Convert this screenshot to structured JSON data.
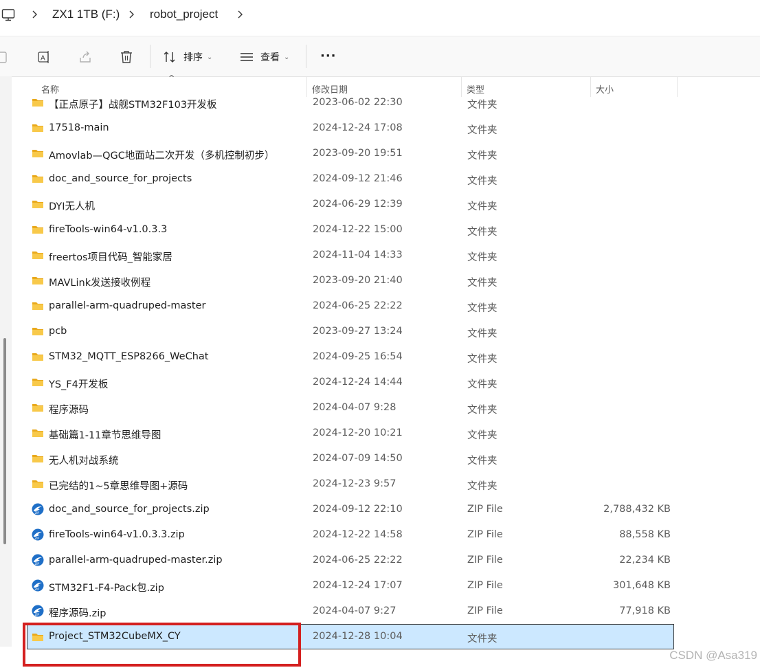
{
  "breadcrumb": {
    "icon": "computer-icon",
    "items": [
      "ZX1 1TB (F:)",
      "robot_project"
    ]
  },
  "toolbar": {
    "sort_label": "排序",
    "view_label": "查看",
    "more_label": "···",
    "icons": [
      "copy-icon",
      "rename-icon",
      "share-icon",
      "delete-icon",
      "sort-icon",
      "view-icon"
    ]
  },
  "columns": {
    "name": "名称",
    "date": "修改日期",
    "type": "类型",
    "size": "大小"
  },
  "files": [
    {
      "name": "【正点原子】战舰STM32F103开发板",
      "date": "2023-06-02 22:30",
      "type": "文件夹",
      "size": "",
      "icon": "folder-icon"
    },
    {
      "name": "17518-main",
      "date": "2024-12-24 17:08",
      "type": "文件夹",
      "size": "",
      "icon": "folder-icon"
    },
    {
      "name": "Amovlab—QGC地面站二次开发（多机控制初步）",
      "date": "2023-09-20 19:51",
      "type": "文件夹",
      "size": "",
      "icon": "folder-icon"
    },
    {
      "name": "doc_and_source_for_projects",
      "date": "2024-09-12 21:46",
      "type": "文件夹",
      "size": "",
      "icon": "folder-icon"
    },
    {
      "name": "DYI无人机",
      "date": "2024-06-29 12:39",
      "type": "文件夹",
      "size": "",
      "icon": "folder-icon"
    },
    {
      "name": "fireTools-win64-v1.0.3.3",
      "date": "2024-12-22 15:00",
      "type": "文件夹",
      "size": "",
      "icon": "folder-icon"
    },
    {
      "name": "freertos项目代码_智能家居",
      "date": "2024-11-04 14:33",
      "type": "文件夹",
      "size": "",
      "icon": "folder-icon"
    },
    {
      "name": "MAVLink发送接收例程",
      "date": "2023-09-20 21:40",
      "type": "文件夹",
      "size": "",
      "icon": "folder-icon"
    },
    {
      "name": "parallel-arm-quadruped-master",
      "date": "2024-06-25 22:22",
      "type": "文件夹",
      "size": "",
      "icon": "folder-icon"
    },
    {
      "name": "pcb",
      "date": "2023-09-27 13:24",
      "type": "文件夹",
      "size": "",
      "icon": "folder-icon"
    },
    {
      "name": "STM32_MQTT_ESP8266_WeChat",
      "date": "2024-09-25 16:54",
      "type": "文件夹",
      "size": "",
      "icon": "folder-icon"
    },
    {
      "name": "YS_F4开发板",
      "date": "2024-12-24 14:44",
      "type": "文件夹",
      "size": "",
      "icon": "folder-icon"
    },
    {
      "name": "程序源码",
      "date": "2024-04-07 9:28",
      "type": "文件夹",
      "size": "",
      "icon": "folder-icon"
    },
    {
      "name": "基础篇1-11章节思维导图",
      "date": "2024-12-20 10:21",
      "type": "文件夹",
      "size": "",
      "icon": "folder-icon"
    },
    {
      "name": "无人机对战系统",
      "date": "2024-07-09 14:50",
      "type": "文件夹",
      "size": "",
      "icon": "folder-icon"
    },
    {
      "name": "已完结的1~5章思维导图+源码",
      "date": "2024-12-23 9:57",
      "type": "文件夹",
      "size": "",
      "icon": "folder-icon"
    },
    {
      "name": "doc_and_source_for_projects.zip",
      "date": "2024-09-12 22:10",
      "type": "ZIP File",
      "size": "2,788,432 KB",
      "icon": "zip-icon"
    },
    {
      "name": "fireTools-win64-v1.0.3.3.zip",
      "date": "2024-12-22 14:58",
      "type": "ZIP File",
      "size": "88,558 KB",
      "icon": "zip-icon"
    },
    {
      "name": "parallel-arm-quadruped-master.zip",
      "date": "2024-06-25 22:22",
      "type": "ZIP File",
      "size": "22,234 KB",
      "icon": "zip-icon"
    },
    {
      "name": "STM32F1-F4-Pack包.zip",
      "date": "2024-12-24 17:07",
      "type": "ZIP File",
      "size": "301,648 KB",
      "icon": "zip-icon"
    },
    {
      "name": "程序源码.zip",
      "date": "2024-04-07 9:27",
      "type": "ZIP File",
      "size": "77,918 KB",
      "icon": "zip-icon"
    },
    {
      "name": "Project_STM32CubeMX_CY",
      "date": "2024-12-28 10:04",
      "type": "文件夹",
      "size": "",
      "icon": "folder-icon",
      "selected": true
    }
  ],
  "watermark": "CSDN @Asa319",
  "colors": {
    "selection": "#cce8ff",
    "folder": "#f3c13a",
    "annotation": "#d42020"
  }
}
